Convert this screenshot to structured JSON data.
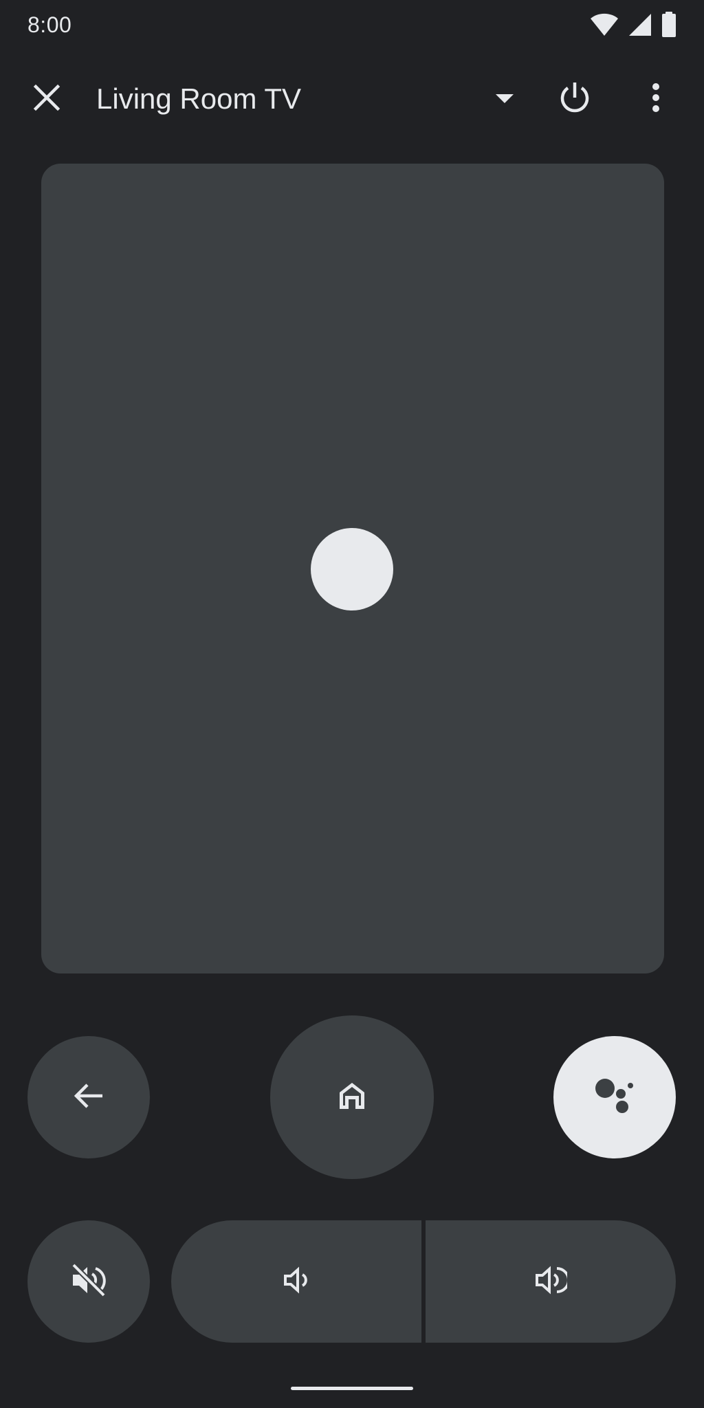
{
  "status_bar": {
    "time": "8:00",
    "icons": [
      "wifi-icon",
      "cell-signal-icon",
      "battery-icon"
    ]
  },
  "app_bar": {
    "device_name": "Living Room TV",
    "icons": [
      "close-icon",
      "dropdown-arrow-icon",
      "power-icon",
      "more-vert-icon"
    ]
  },
  "remote": {
    "touchpad": "touchpad",
    "buttons": [
      "back",
      "home",
      "assistant",
      "mute",
      "volume-down",
      "volume-up"
    ]
  },
  "colors": {
    "background": "#202124",
    "surface": "#3c4043",
    "on_surface": "#e8eaed"
  }
}
